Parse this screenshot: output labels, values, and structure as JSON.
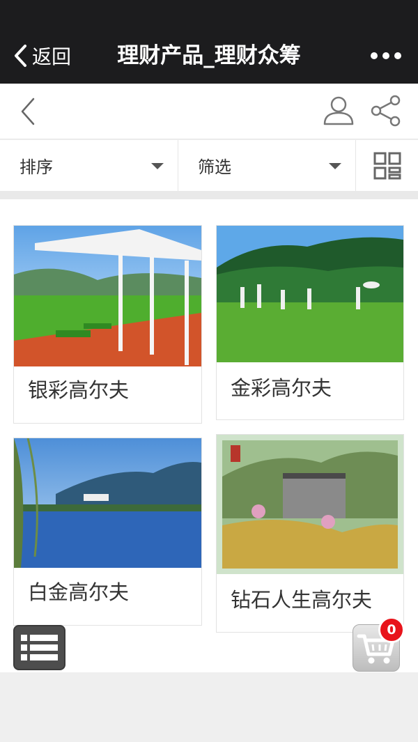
{
  "topbar": {
    "back_label": "返回",
    "title": "理财产品_理财众筹"
  },
  "filterbar": {
    "sort_label": "排序",
    "filter_label": "筛选"
  },
  "products": [
    {
      "name": "银彩高尔夫"
    },
    {
      "name": "金彩高尔夫"
    },
    {
      "name": "白金高尔夫"
    },
    {
      "name": "钻石人生高尔夫"
    }
  ],
  "cart": {
    "count": "0"
  },
  "colors": {
    "topbar_bg": "#1c1c1e",
    "badge": "#e8141b",
    "grass": "#4fae2e"
  }
}
